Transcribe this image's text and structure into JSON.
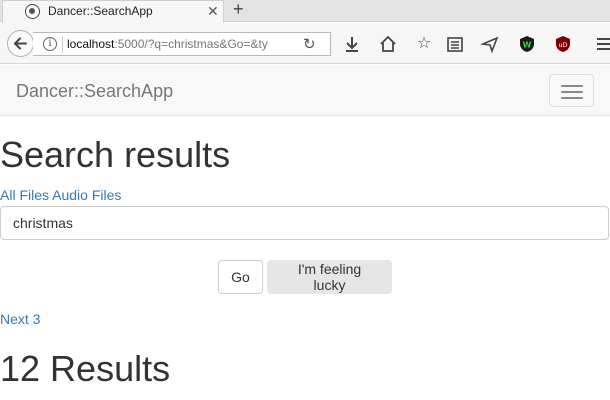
{
  "browser": {
    "tab": {
      "title": "Dancer::SearchApp"
    },
    "url": {
      "host": "localhost",
      "rest": ":5000/?q=christmas&Go=&ty"
    }
  },
  "app": {
    "brand": "Dancer::SearchApp",
    "heading": "Search results",
    "filters": [
      "All Files",
      "Audio Files"
    ],
    "search": {
      "value": "christmas"
    },
    "buttons": {
      "go": "Go",
      "lucky": "I'm feeling lucky"
    },
    "pagination": {
      "next": "Next 3"
    },
    "results_heading": "12 Results"
  },
  "icons": {
    "nav": [
      "download-icon",
      "home-icon",
      "bookmark-star-icon",
      "reading-list-icon",
      "send-icon",
      "w-shield-extension-icon",
      "ublock-icon",
      "menu-icon"
    ]
  },
  "colors": {
    "link": "#337ab7",
    "navbar_bg": "#f8f8f8"
  }
}
